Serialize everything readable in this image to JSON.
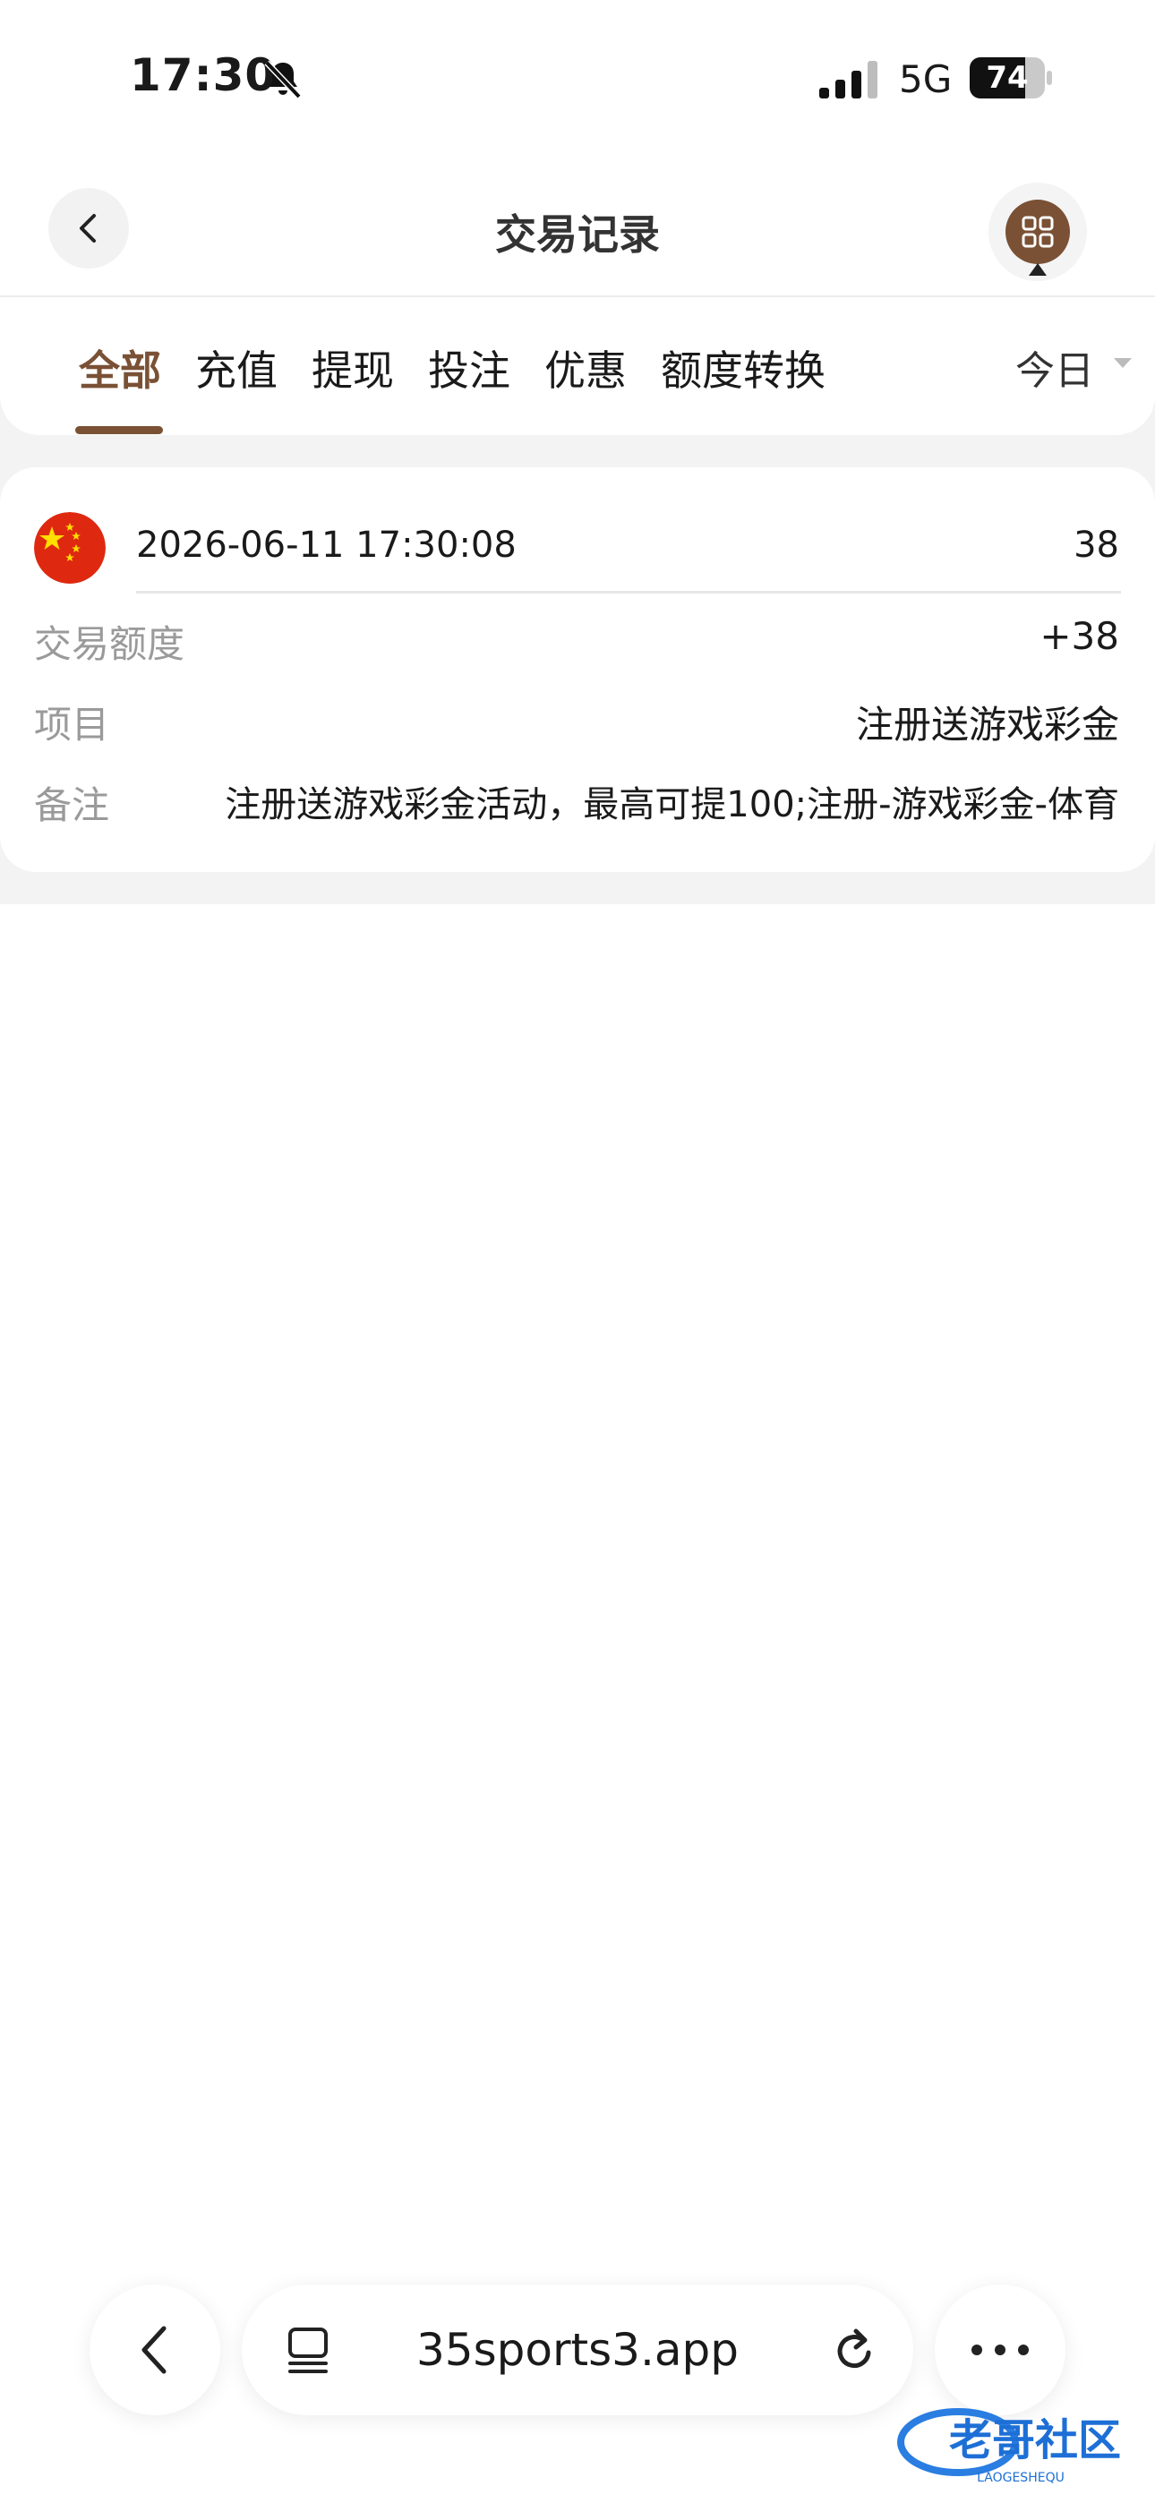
{
  "status_bar": {
    "time": "17:30",
    "network": "5G",
    "battery_level": "74",
    "battery_fraction": 0.74
  },
  "header": {
    "title": "交易记录"
  },
  "tabs": {
    "items": [
      {
        "label": "全部",
        "active": true
      },
      {
        "label": "充值",
        "active": false
      },
      {
        "label": "提现",
        "active": false
      },
      {
        "label": "投注",
        "active": false
      },
      {
        "label": "优惠",
        "active": false
      },
      {
        "label": "额度转换",
        "active": false
      }
    ],
    "date_filter": "今日"
  },
  "record": {
    "datetime": "2026-06-11 17:30:08",
    "balance": "38",
    "rows": [
      {
        "label": "交易额度",
        "value": "+38"
      },
      {
        "label": "项目",
        "value": "注册送游戏彩金"
      },
      {
        "label": "备注",
        "value": "注册送游戏彩金活动，最高可提100;注册-游戏彩金-体育"
      }
    ]
  },
  "browser": {
    "url": "35sports3.app"
  },
  "watermark": {
    "text": "老哥社区",
    "subtext": "LAOGESHEQU"
  },
  "colors": {
    "accent": "#7a5135",
    "flag_red": "#de2910",
    "flag_star": "#ffde00"
  }
}
